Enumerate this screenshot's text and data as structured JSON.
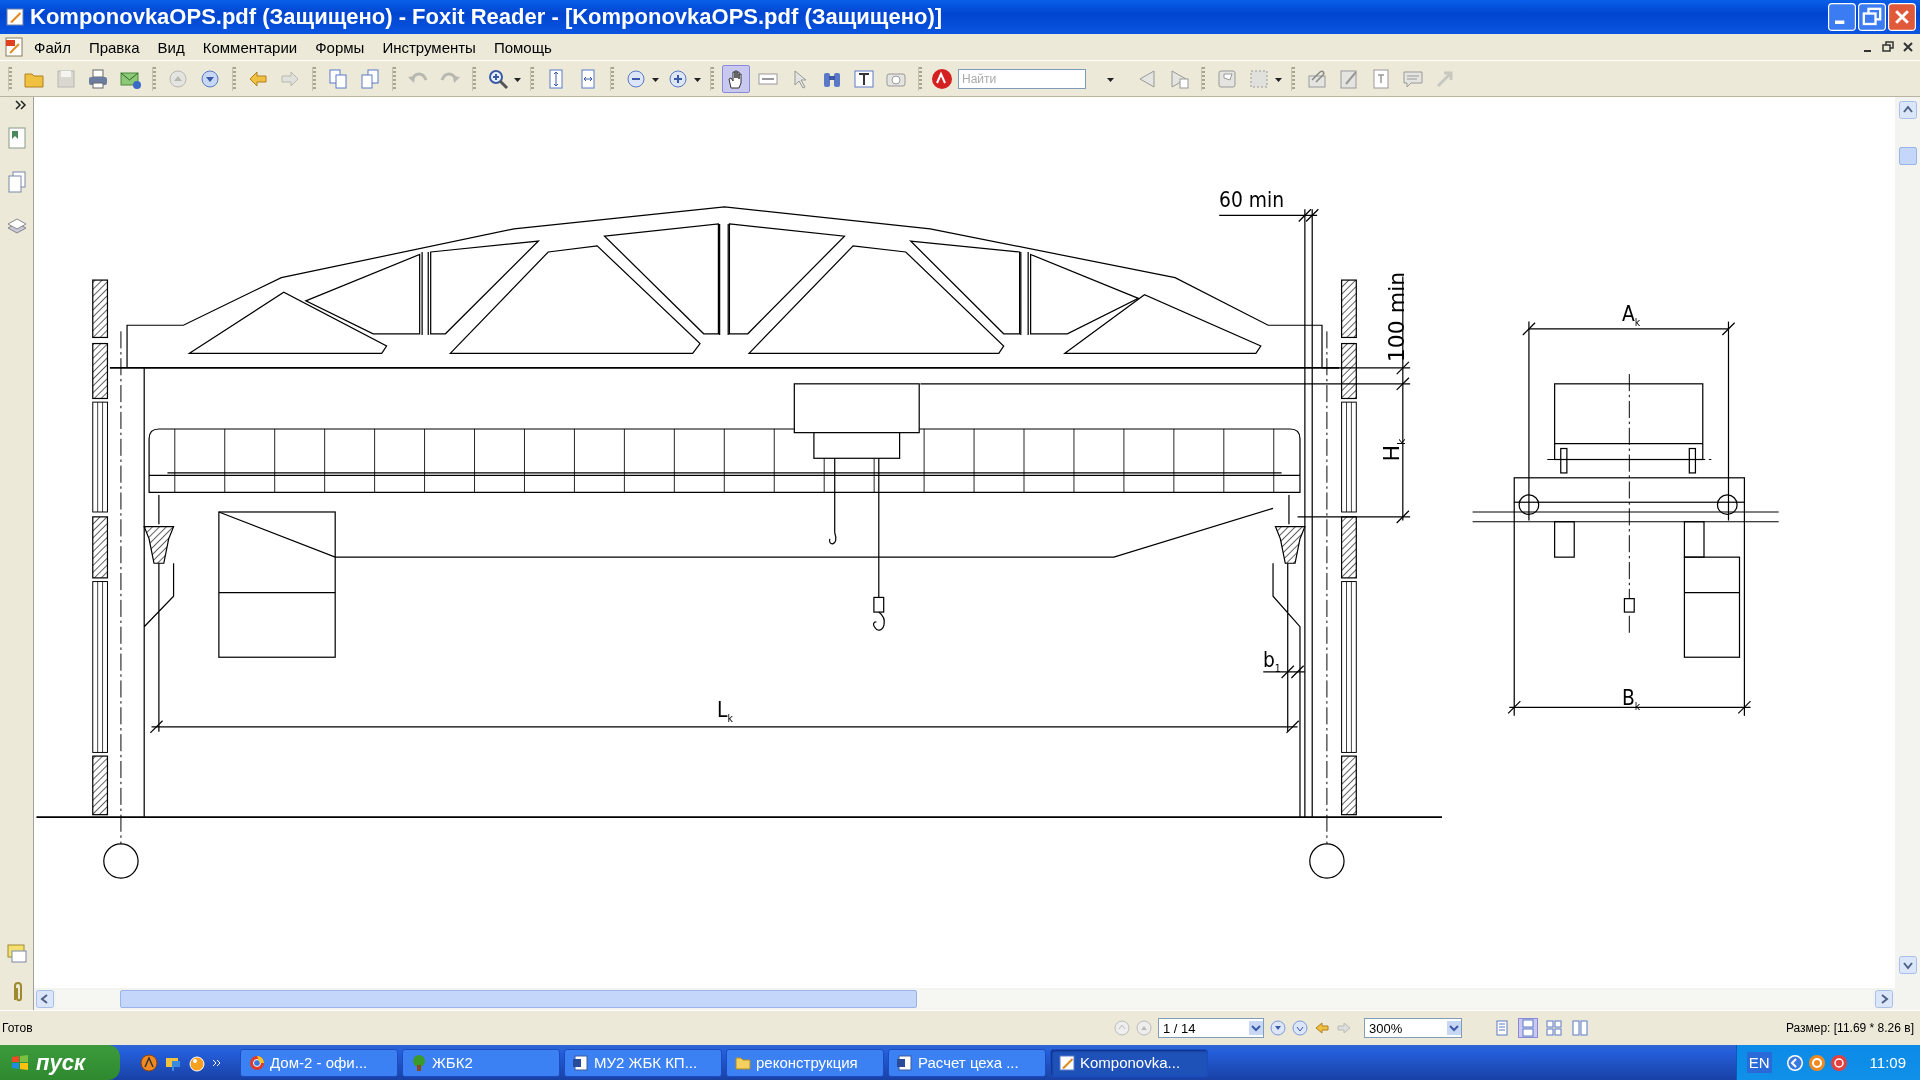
{
  "window": {
    "title": "KomponovkaOPS.pdf (Защищено) - Foxit Reader - [KomponovkaOPS.pdf (Защищено)]"
  },
  "menu": [
    "Файл",
    "Правка",
    "Вид",
    "Комментарии",
    "Формы",
    "Инструменты",
    "Помощь"
  ],
  "toolbar": {
    "hand_tool": {
      "selected": true
    },
    "search": {
      "placeholder": "Найти"
    }
  },
  "drawing": {
    "labels": [
      {
        "kind": "horizontal",
        "text": "60 min"
      },
      {
        "kind": "vertical",
        "text": "100 min"
      },
      {
        "kind": "vertical",
        "text": "H$_{k}$"
      },
      {
        "kind": "horizontal",
        "text": "b$_{1}$"
      },
      {
        "kind": "horizontal",
        "text": "L$_{k}$"
      },
      {
        "kind": "horizontal",
        "text": "A$_{k}$"
      },
      {
        "kind": "horizontal",
        "text": "B$_{k}$"
      }
    ]
  },
  "status_bar": {
    "status": "Готов",
    "page": "1 / 14",
    "zoom": "300%",
    "size": "Размер: [11.69 * 8.26 в]",
    "view_modes": [
      {
        "selected": false
      },
      {
        "selected": true
      },
      {
        "selected": false
      },
      {
        "selected": false
      }
    ]
  },
  "taskbar": {
    "start": "пуск",
    "tasks": [
      {
        "label": "Дом-2 - офи...",
        "kind": "browser",
        "selected": false
      },
      {
        "label": "ЖБК2",
        "kind": "tree",
        "selected": false
      },
      {
        "label": "МУ2 ЖБК КП...",
        "kind": "document",
        "selected": false
      },
      {
        "label": "реконструкция",
        "kind": "folder",
        "selected": false
      },
      {
        "label": "Расчет цеха ...",
        "kind": "document",
        "selected": false
      },
      {
        "label": "Komponovka...",
        "kind": "reader",
        "selected": true
      }
    ],
    "language": "EN",
    "clock": "11:09"
  }
}
